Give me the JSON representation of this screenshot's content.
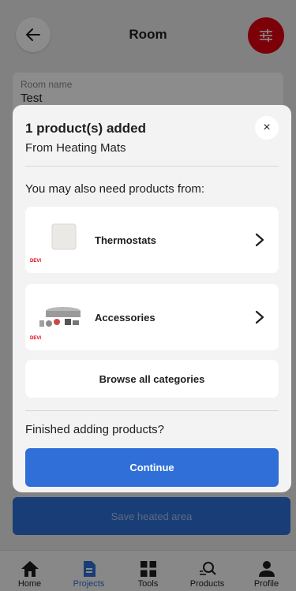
{
  "header": {
    "title": "Room",
    "back_icon": "arrow-left-icon",
    "filter_icon": "sliders-icon"
  },
  "room": {
    "label": "Room name",
    "value": "Test"
  },
  "save_button": "Save heated area",
  "modal": {
    "title": "1 product(s) added",
    "subtitle": "From Heating Mats",
    "close": "×",
    "need_text": "You may also need products from:",
    "categories": [
      {
        "label": "Thermostats",
        "brand": "DEVI"
      },
      {
        "label": "Accessories",
        "brand": "DEVI"
      }
    ],
    "browse_label": "Browse all categories",
    "finished_text": "Finished adding products?",
    "continue_label": "Continue"
  },
  "nav": [
    {
      "label": "Home",
      "icon": "home-icon",
      "active": false
    },
    {
      "label": "Projects",
      "icon": "document-icon",
      "active": true
    },
    {
      "label": "Tools",
      "icon": "grid-icon",
      "active": false
    },
    {
      "label": "Products",
      "icon": "search-icon",
      "active": false
    },
    {
      "label": "Profile",
      "icon": "user-icon",
      "active": false
    }
  ],
  "colors": {
    "primary": "#2f6fd7",
    "accent": "#e2000f",
    "brand_blue": "#1a3d8f"
  }
}
